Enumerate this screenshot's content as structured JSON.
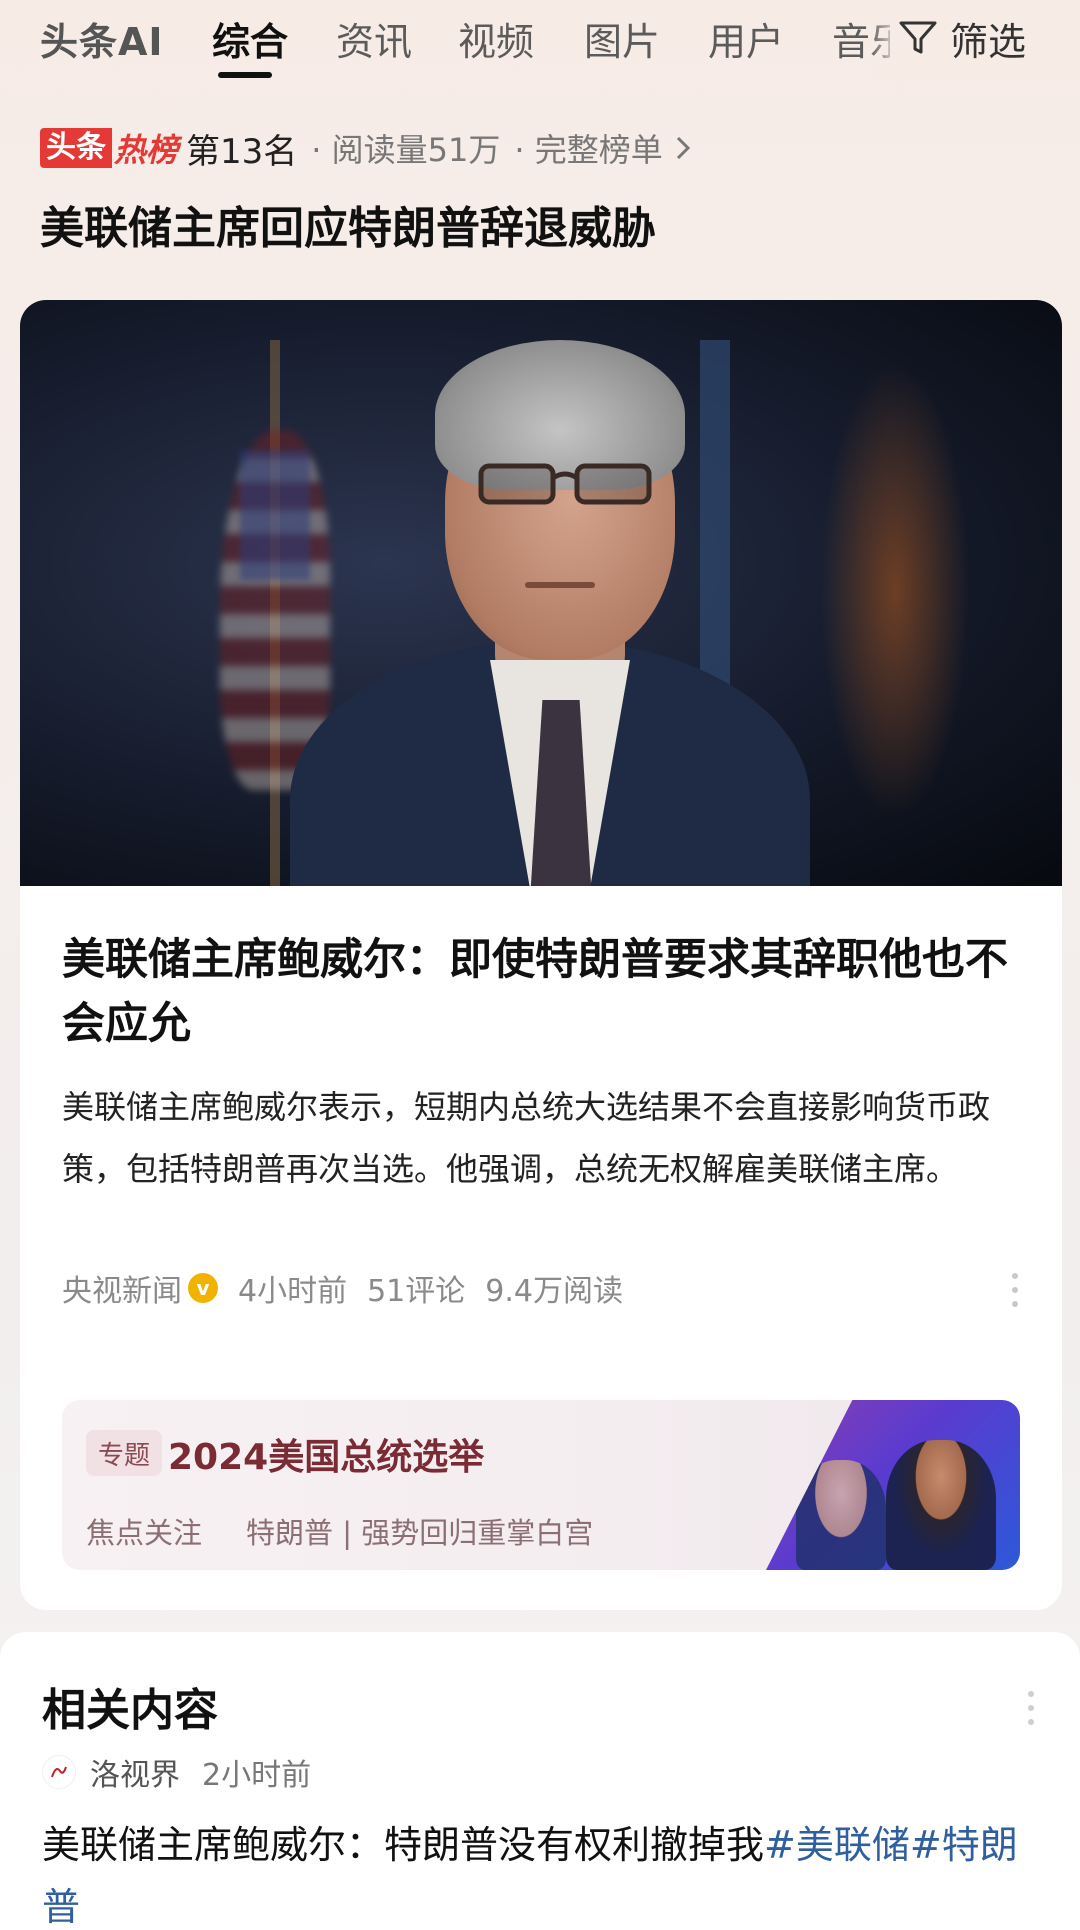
{
  "tabs": {
    "logo": "头条AI",
    "items": [
      "综合",
      "资讯",
      "视频",
      "图片",
      "用户",
      "音乐"
    ],
    "active_index": 0,
    "filter_label": "筛选"
  },
  "hot": {
    "badge_part1": "头条",
    "badge_part2": "热榜",
    "rank": "第13名",
    "reads": "· 阅读量51万",
    "full_list": "· 完整榜单"
  },
  "headline": "美联储主席回应特朗普辞退威胁",
  "article": {
    "title": "美联储主席鲍威尔：即使特朗普要求其辞职他也不会应允",
    "summary": "美联储主席鲍威尔表示，短期内总统大选结果不会直接影响货币政策，包括特朗普再次当选。他强调，总统无权解雇美联储主席。",
    "source": "央视新闻",
    "verified_mark": "v",
    "time": "4小时前",
    "comments": "51评论",
    "reads": "9.4万阅读"
  },
  "topic": {
    "tag": "专题",
    "title": "2024美国总统选举",
    "sub_label": "焦点关注",
    "sub_text": "特朗普 | 强势回归重掌白宫"
  },
  "related": {
    "title": "相关内容",
    "author": "洛视界",
    "time": "2小时前",
    "text_main": "美联储主席鲍威尔：特朗普没有权利撤掉我",
    "hashtag1": "#美联储",
    "hashtag2": "#特朗普"
  },
  "colors": {
    "hot_red": "#e53935",
    "topic_title": "#7a2b34",
    "hashtag_blue": "#2f5f9e"
  }
}
